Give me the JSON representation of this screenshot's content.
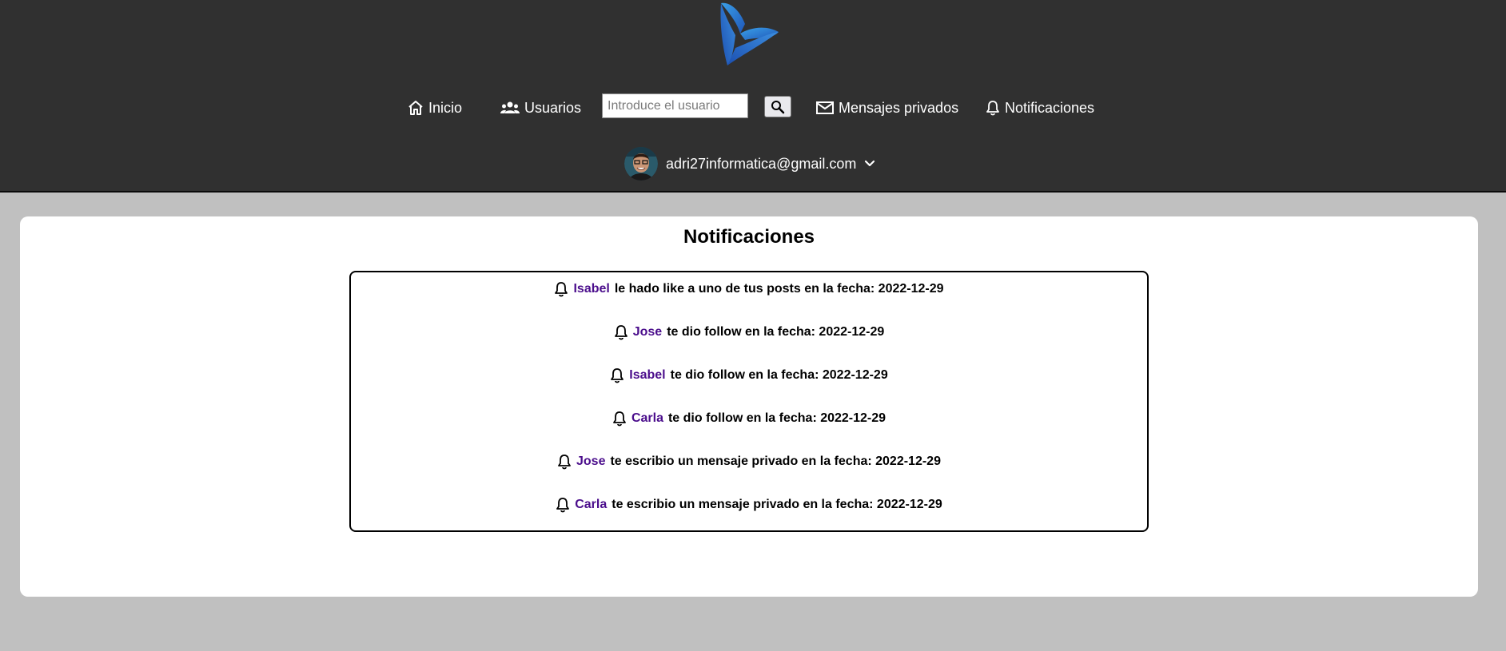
{
  "header": {
    "nav": {
      "home_label": "Inicio",
      "users_label": "Usuarios",
      "messages_label": "Mensajes privados",
      "notifications_label": "Notificaciones"
    },
    "search": {
      "placeholder": "Introduce el usuario",
      "value": ""
    },
    "user": {
      "email": "adri27informatica@gmail.com"
    },
    "icons": [
      "logo",
      "home-icon",
      "users-icon",
      "search-icon",
      "mail-icon",
      "bell-icon",
      "avatar",
      "chevron-down-icon"
    ],
    "colors": {
      "bar": "#303030",
      "text": "#ffffff"
    }
  },
  "main": {
    "title": "Notificaciones",
    "notifications": [
      {
        "user": "Isabel",
        "text": "le hado like a uno de tus posts en la fecha: 2022-12-29"
      },
      {
        "user": "Jose",
        "text": "te dio follow en la fecha: 2022-12-29"
      },
      {
        "user": "Isabel",
        "text": "te dio follow en la fecha: 2022-12-29"
      },
      {
        "user": "Carla",
        "text": "te dio follow en la fecha: 2022-12-29"
      },
      {
        "user": "Jose",
        "text": "te escribio un mensaje privado en la fecha: 2022-12-29"
      },
      {
        "user": "Carla",
        "text": "te escribio un mensaje privado en la fecha: 2022-12-29"
      }
    ],
    "colors": {
      "background": "#c0c0c0",
      "card": "#ffffff",
      "user_link": "#4b0e8c"
    }
  }
}
